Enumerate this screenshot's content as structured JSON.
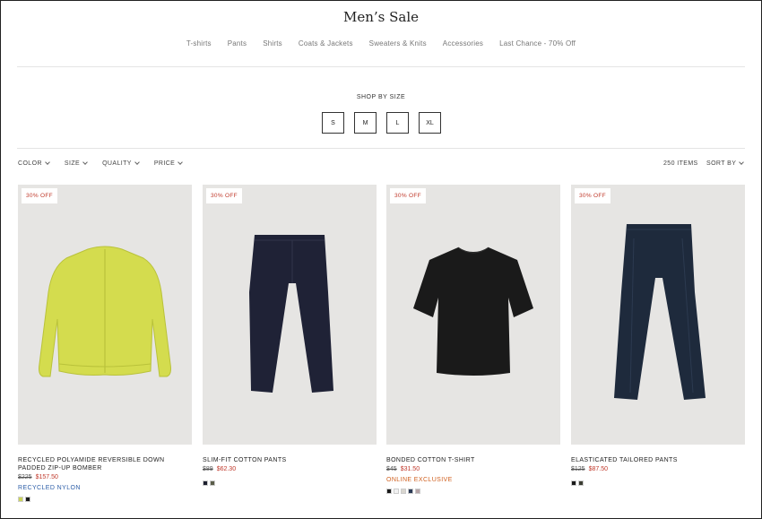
{
  "page_title": "Men’s Sale",
  "nav": [
    "T-shirts",
    "Pants",
    "Shirts",
    "Coats & Jackets",
    "Sweaters & Knits",
    "Accessories",
    "Last Chance - 70% Off"
  ],
  "shop_by_size": {
    "label": "SHOP BY SIZE",
    "sizes": [
      "S",
      "M",
      "L",
      "XL"
    ]
  },
  "filters": [
    "COLOR",
    "SIZE",
    "QUALITY",
    "PRICE"
  ],
  "items_count": "250 ITEMS",
  "sort_label": "SORT BY",
  "colors": {
    "sale_red": "#c0392b",
    "recycled_blue": "#2e5fa8",
    "exclusive_orange": "#d0601f"
  },
  "products": [
    {
      "badge": "30% OFF",
      "name": "RECYCLED POLYAMIDE REVERSIBLE DOWN PADDED ZIP-UP BOMBER",
      "old_price": "$225",
      "new_price": "$157.50",
      "tag": "RECYCLED NYLON",
      "swatches": [
        "#c9d35a",
        "#1a1a1a"
      ]
    },
    {
      "badge": "30% OFF",
      "name": "SLIM-FIT COTTON PANTS",
      "old_price": "$89",
      "new_price": "$62.30",
      "tag": "",
      "swatches": [
        "#1c1f2e",
        "#5b5e4a"
      ]
    },
    {
      "badge": "30% OFF",
      "name": "BONDED COTTON T-SHIRT",
      "old_price": "$45",
      "new_price": "$31.50",
      "tag": "ONLINE EXCLUSIVE",
      "swatches": [
        "#1a1a1a",
        "#f2f2f2",
        "#d9d6d0",
        "#2b3a55",
        "#b7a5a8"
      ]
    },
    {
      "badge": "30% OFF",
      "name": "ELASTICATED TAILORED PANTS",
      "old_price": "$125",
      "new_price": "$87.50",
      "tag": "",
      "swatches": [
        "#1a1a1a",
        "#3b3d33"
      ]
    }
  ]
}
